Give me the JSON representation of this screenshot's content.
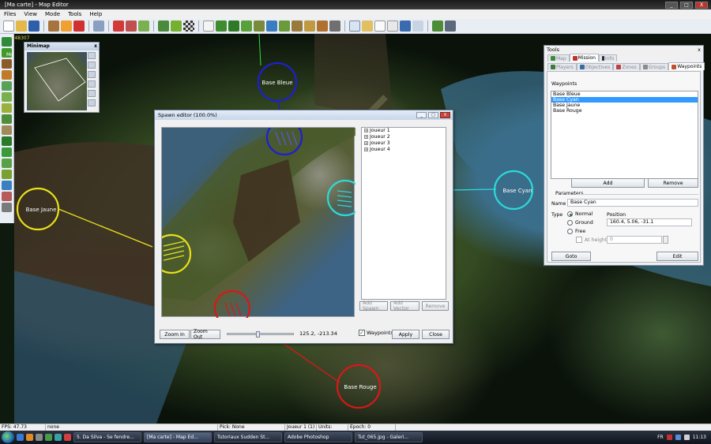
{
  "window": {
    "title": "[Ma carte] - Map Editor",
    "controls": [
      "_",
      "□",
      "X"
    ]
  },
  "menu": [
    "Files",
    "View",
    "Mode",
    "Tools",
    "Help"
  ],
  "viewport": {
    "rid": "r48307",
    "mo": "Mo"
  },
  "minimap": {
    "title": "Minimap",
    "close": "x"
  },
  "map_labels": {
    "blue": "Base Bleue",
    "cyan": "Base Cyan",
    "yellow": "Base Jaune",
    "red": "Base Rouge"
  },
  "spawn_editor": {
    "title": "Spawn editor (100.0%)",
    "tree": [
      "Joueur 1",
      "Joueur 2",
      "Joueur 3",
      "Joueur 4"
    ],
    "buttons": {
      "add_spawn": "Add Spawn",
      "add_vector": "Add Vector",
      "remove": "Remove"
    },
    "zoom_in": "Zoom In",
    "zoom_out": "Zoom Out",
    "coords": "125.2, -213.34",
    "waypoints_label": "Waypoints",
    "apply": "Apply",
    "close": "Close"
  },
  "tools": {
    "title": "Tools",
    "close": "x",
    "top_tabs": [
      "Map",
      "Mission",
      "Info"
    ],
    "sub_tabs": [
      "Players",
      "Objectives",
      "Zones",
      "Groups",
      "Waypoints"
    ],
    "waypoints_heading": "Waypoints",
    "waypoints": [
      "Base Bleue",
      "Base Cyan",
      "Base Jaune",
      "Base Rouge"
    ],
    "selected_index": 1,
    "add": "Add",
    "remove": "Remove",
    "parameters": "Parameters",
    "name_label": "Name",
    "name_value": "Base Cyan",
    "type_label": "Type",
    "types": [
      "Normal",
      "Ground",
      "Free"
    ],
    "selected_type": "Normal",
    "position_label": "Position",
    "position_value": "160.4, 5.06, -31.1",
    "at_height_label": "At height",
    "at_height_value": "0",
    "goto": "Goto",
    "edit": "Edit"
  },
  "status": {
    "fps": "FPS: 47.73",
    "selection": "none",
    "pick": "Pick: None",
    "player": "Joueur 1 (1)",
    "units": "Units:",
    "epoch": "Epoch: 0"
  },
  "taskbar": {
    "tasks": [
      "5. Da Silva - Se fendre...",
      "[Ma carte] - Map Ed...",
      "Tutoriaux Sudden St...",
      "Adobe Photoshop",
      "Tut_065.jpg - Galeri..."
    ],
    "lang": "FR",
    "time": "11:13"
  },
  "colors": {
    "blue": "#1f1fd0",
    "cyan": "#2cdada",
    "yellow": "#e8e01a",
    "red": "#d81818",
    "selection": "#3399ff"
  }
}
